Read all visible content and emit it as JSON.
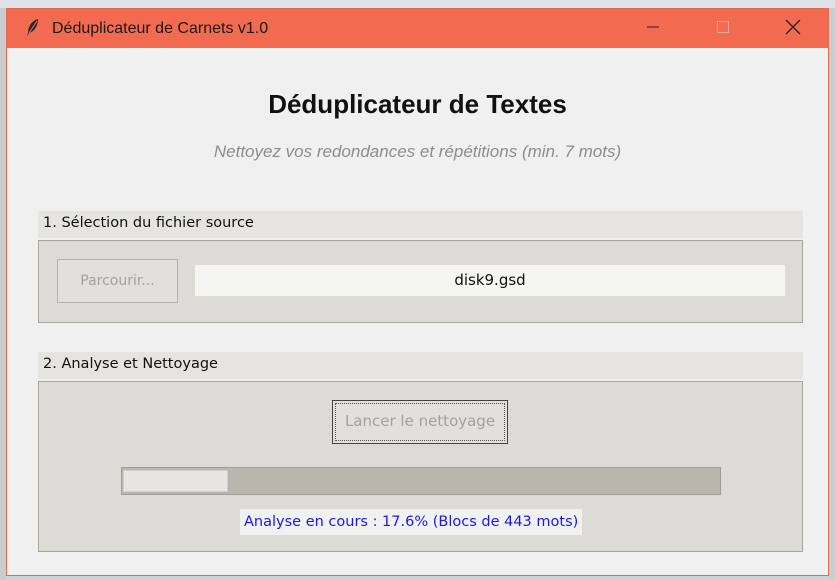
{
  "window": {
    "title": "Déduplicateur de Carnets v1.0",
    "icon": "feather-icon",
    "controls": [
      "minimize-icon",
      "maximize-icon",
      "close-icon"
    ],
    "titlebar_color": "#f26b51"
  },
  "header": {
    "title": "Déduplicateur de Textes",
    "subtitle": "Nettoyez vos redondances et répétitions (min. 7 mots)"
  },
  "section_source": {
    "label": "1. Sélection du fichier source",
    "browse_button": "Parcourir...",
    "file_value": "disk9.gsd"
  },
  "section_analysis": {
    "label": "2. Analyse et Nettoyage",
    "run_button": "Lancer le nettoyage",
    "progress_fraction": 0.176,
    "status": "Analyse en cours : 17.6% (Blocs de 443 mots)",
    "status_color": "#1a1add"
  }
}
